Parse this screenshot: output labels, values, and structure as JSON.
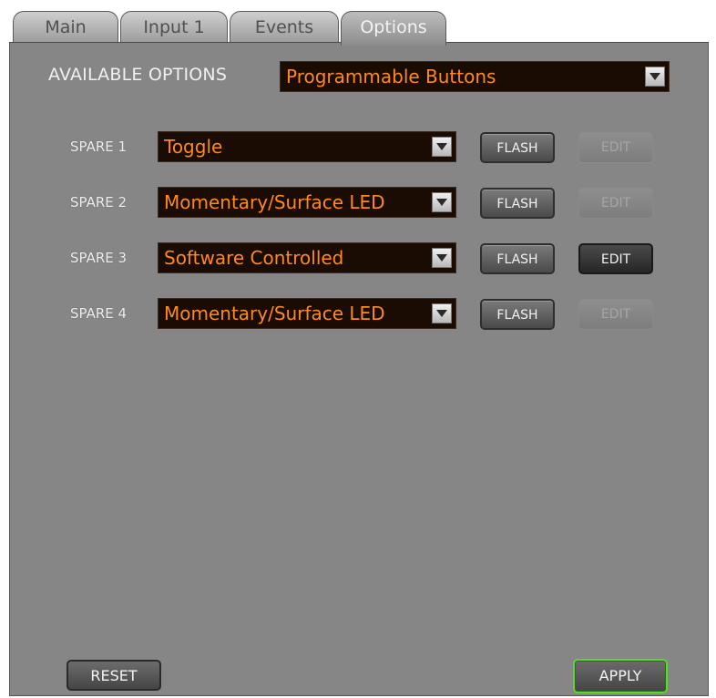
{
  "tabs": [
    {
      "label": "Main"
    },
    {
      "label": "Input 1"
    },
    {
      "label": "Events"
    },
    {
      "label": "Options",
      "active": true
    }
  ],
  "available_options": {
    "label": "AVAILABLE OPTIONS",
    "value": "Programmable Buttons"
  },
  "spares": [
    {
      "label": "SPARE 1",
      "mode": "Toggle",
      "flash_label": "FLASH",
      "edit_label": "EDIT",
      "edit_enabled": false
    },
    {
      "label": "SPARE 2",
      "mode": "Momentary/Surface LED",
      "flash_label": "FLASH",
      "edit_label": "EDIT",
      "edit_enabled": false
    },
    {
      "label": "SPARE 3",
      "mode": "Software Controlled",
      "flash_label": "FLASH",
      "edit_label": "EDIT",
      "edit_enabled": true
    },
    {
      "label": "SPARE 4",
      "mode": "Momentary/Surface LED",
      "flash_label": "FLASH",
      "edit_label": "EDIT",
      "edit_enabled": false
    }
  ],
  "footer": {
    "reset_label": "RESET",
    "apply_label": "APPLY"
  },
  "colors": {
    "panel_bg": "#868686",
    "select_bg": "#1a0b03",
    "select_text": "#ff8a1c",
    "apply_border": "#5fd33a"
  }
}
